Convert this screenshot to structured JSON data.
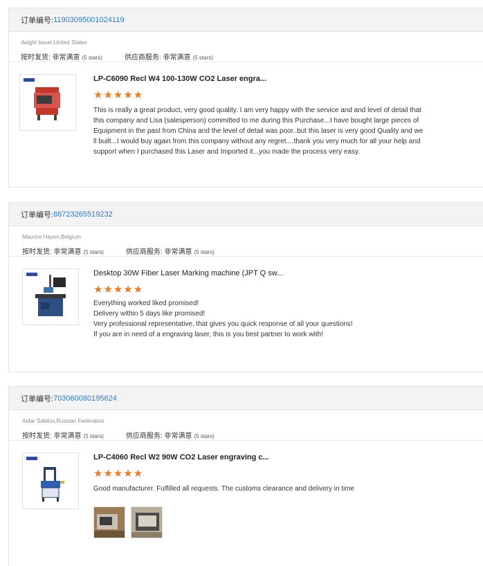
{
  "reviews": [
    {
      "order_label": "订单编号:",
      "order_number": "11903095001024119",
      "buyer": "dwight bauer,United States",
      "shipping_label": "按时发货: 非常满意",
      "shipping_stars": "(5 stars)",
      "service_label": "供应商服务: 非常满意",
      "service_stars": "(5 stars)",
      "product_title": "LP-C6090 Recl W4 100-130W CO2 Laser engra...",
      "stars": "★★★★★",
      "review_lines": [
        "This is really a great product, very good quality. I am very happy with the service and and level of detail that",
        "this company and Lisa (salesperson) committed to me during this Purchase...I have bought large pieces of",
        "Equipment in the past from China and the level of detail was poor..but this laser is very good Quality and we",
        "ll built...I would buy again from this company without any regret....thank you very much for all your help and",
        "support when I purchased this Laser and Imported it...you made the process very easy."
      ]
    },
    {
      "order_label": "订单编号:",
      "order_number": "88723265519232",
      "buyer": "Maurice Hayen,Belgium",
      "shipping_label": "按时发货: 非常满意",
      "shipping_stars": "(5 stars)",
      "service_label": "供应商服务: 非常满意",
      "service_stars": "(5 stars)",
      "product_title": "Desktop 30W Fiber Laser Marking machine (JPT Q sw...",
      "stars": "★★★★★",
      "review_lines": [
        "Everything worked liked promised!",
        "Delivery within 5 days like promised!",
        "Very professional representative, that gives you quick response of all your questions!",
        "If you are in need of a engraving laser, this is you best partner to work with!"
      ]
    },
    {
      "order_label": "订单编号:",
      "order_number": "703060080195624",
      "buyer": "Aidar Sabitov,Russian Federation",
      "shipping_label": "按时发货: 非常满意",
      "shipping_stars": "(5 stars)",
      "service_label": "供应商服务: 非常满意",
      "service_stars": "(5 stars)",
      "product_title": "LP-C4060 Recl W2 90W CO2 Laser engraving c...",
      "stars": "★★★★★",
      "review_lines": [
        "Good manufacturer. Fulfilled all requests. The customs clearance and delivery in time"
      ]
    }
  ],
  "colors": {
    "order_link": "#2b7bd1",
    "star": "#f07a1c",
    "header_bg": "#f3f3f3"
  },
  "icons": [
    "laser-engraver-red-thumbnail",
    "fiber-marking-machine-thumbnail",
    "laser-engraver-blue-thumbnail",
    "buyer-photo-thumbnail"
  ]
}
